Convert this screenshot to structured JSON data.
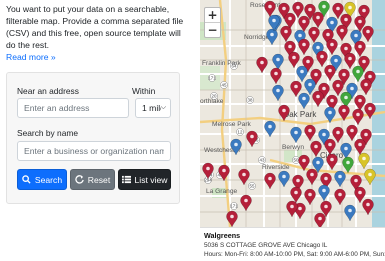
{
  "intro": {
    "text": "You want to put your data on a searchable, filterable map. Provide a comma separated file (CSV) and this free, open source template will do the rest.",
    "read_more": "Read more »"
  },
  "search_panel": {
    "address_label": "Near an address",
    "address_placeholder": "Enter an address",
    "within_label": "Within",
    "within_value": "1 mile",
    "name_label": "Search by name",
    "name_placeholder": "Enter a business or organization name",
    "search_button": "Search",
    "reset_button": "Reset",
    "list_button": "List view"
  },
  "map": {
    "zoom_in": "+",
    "zoom_out": "−",
    "labels": {
      "rosemont": "Rosemont",
      "norridge": "Norridge",
      "franklin_park": "Franklin Park",
      "northlake": "orthlake",
      "melrose_park": "Melrose Park",
      "oak_park": "Oak Park",
      "westchester": "Westchester",
      "berwyn": "Berwyn",
      "cicero": "Cicero",
      "riverside": "Riverside",
      "la_grange": "La Grange"
    },
    "highways": [
      "19",
      "64",
      "45",
      "171",
      "20",
      "38",
      "12",
      "56",
      "43",
      "50",
      "34",
      "45",
      "294",
      "55",
      "171"
    ],
    "popup": {
      "title": "Walgreens",
      "address": "5036 S COTTAGE GROVE AVE Chicago IL",
      "hours": "Hours: Mon-Fri: 8:00 AM-10:00 PM, Sat: 9:00 AM-6:00 PM, Sun: 10:00 AM-6:00 PM"
    },
    "marker_colors": {
      "red": "#b5203a",
      "blue": "#3b7ac0",
      "green": "#41a63c",
      "yellow": "#d8c429"
    }
  }
}
